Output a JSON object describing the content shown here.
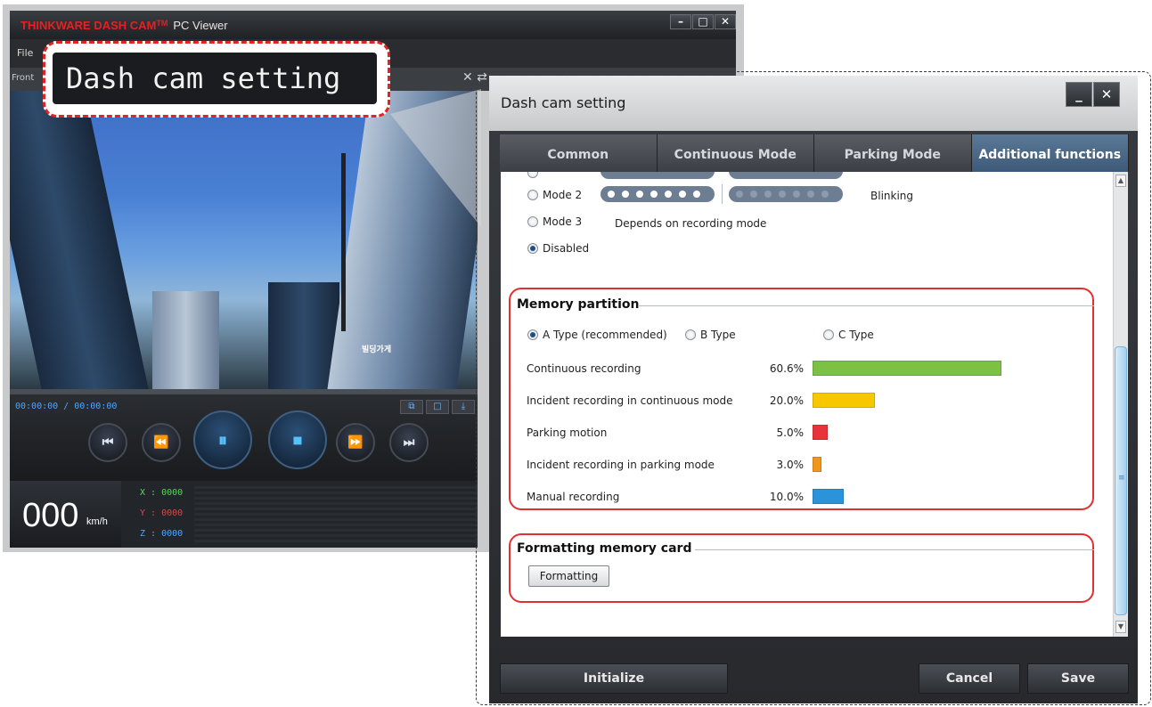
{
  "viewer": {
    "title_brand": "THINKWARE DASH CAM",
    "title_tm": "TM",
    "title_suffix": "PC Viewer",
    "menu_file": "File",
    "front_label": "Front",
    "minimize": "–",
    "maximize": "□",
    "close": "✕",
    "time": "00:00:00 / 00:00:00",
    "speed_value": "000",
    "speed_unit": "km/h",
    "gsensor_x": "X : 0000",
    "gsensor_y": "Y : 0000",
    "gsensor_z": "Z : 0000",
    "controls": {
      "prev": "⏮",
      "rewind": "⏪",
      "pause": "⏸",
      "stop": "⏹",
      "forward": "⏩",
      "next": "⏭"
    },
    "sign_text": "빌딩가게"
  },
  "callout": {
    "text": "Dash cam setting"
  },
  "dialog": {
    "title": "Dash cam setting",
    "minimize": "_",
    "close": "✕",
    "tabs": [
      "Common",
      "Continuous Mode",
      "Parking Mode",
      "Additional functions"
    ],
    "active_tab": 3,
    "led_modes": [
      {
        "label": "Mode 2",
        "description": "Blinking",
        "checked": false
      },
      {
        "label": "Mode 3",
        "description": "Depends on recording mode",
        "checked": false
      },
      {
        "label": "Disabled",
        "description": "",
        "checked": true
      }
    ],
    "memory_partition": {
      "title": "Memory partition",
      "types": [
        {
          "label": "A Type (recommended)",
          "checked": true
        },
        {
          "label": "B Type",
          "checked": false
        },
        {
          "label": "C Type",
          "checked": false
        }
      ],
      "rows": [
        {
          "label": "Continuous recording",
          "percent": "60.6%",
          "value": 60.6,
          "color": "#7cc044"
        },
        {
          "label": "Incident recording in continuous mode",
          "percent": "20.0%",
          "value": 20.0,
          "color": "#f7c800"
        },
        {
          "label": "Parking motion",
          "percent": "5.0%",
          "value": 5.0,
          "color": "#e8333a"
        },
        {
          "label": "Incident recording in parking mode",
          "percent": "3.0%",
          "value": 3.0,
          "color": "#f0961c"
        },
        {
          "label": "Manual recording",
          "percent": "10.0%",
          "value": 10.0,
          "color": "#2a93d9"
        }
      ]
    },
    "formatting": {
      "title": "Formatting memory card",
      "button": "Formatting"
    },
    "footer": {
      "initialize": "Initialize",
      "cancel": "Cancel",
      "save": "Save"
    }
  }
}
